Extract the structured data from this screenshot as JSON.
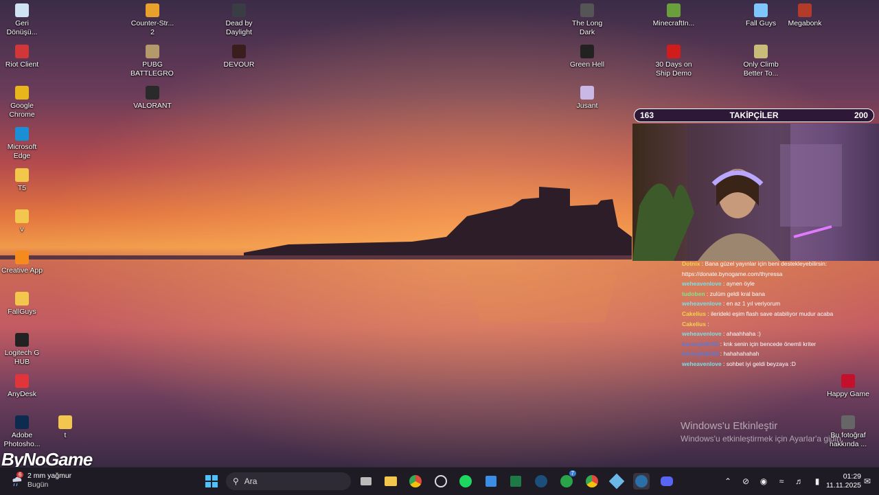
{
  "desktop_icons": [
    {
      "label": "Geri Dönüşü...",
      "icon": "recycle-bin-icon",
      "color": "#cfe3f2"
    },
    {
      "label": "Riot Client",
      "icon": "riot-icon",
      "color": "#d13639"
    },
    {
      "label": "Google Chrome",
      "icon": "chrome-icon",
      "color": "#e8b51c"
    },
    {
      "label": "Microsoft Edge",
      "icon": "edge-icon",
      "color": "#1a8fd6"
    },
    {
      "label": "T5",
      "icon": "shortcut-icon",
      "color": "#f2c84b"
    },
    {
      "label": "v",
      "icon": "folder-icon",
      "color": "#f3c74d"
    },
    {
      "label": "Creative App",
      "icon": "creative-app-icon",
      "color": "#f58a1f"
    },
    {
      "label": "FallGuys",
      "icon": "folder-icon",
      "color": "#f3c74d"
    },
    {
      "label": "Logitech G HUB",
      "icon": "logitech-icon",
      "color": "#222222"
    },
    {
      "label": "AnyDesk",
      "icon": "anydesk-icon",
      "color": "#e0353a"
    },
    {
      "label": "Adobe Photosho...",
      "icon": "photoshop-icon",
      "color": "#0d2b4f"
    },
    {
      "label": "t",
      "icon": "folder-icon",
      "color": "#f3c74d"
    },
    {
      "label": "Counter-Str... 2",
      "icon": "cs2-icon",
      "color": "#e8a12a"
    },
    {
      "label": "PUBG BATTLEGRO...",
      "icon": "pubg-icon",
      "color": "#b49a6a"
    },
    {
      "label": "VALORANT",
      "icon": "valorant-icon",
      "color": "#2a2a2a"
    },
    {
      "label": "Dead by Daylight",
      "icon": "dbd-icon",
      "color": "#3a3d44"
    },
    {
      "label": "DEVOUR",
      "icon": "devour-icon",
      "color": "#3a1d1d"
    },
    {
      "label": "The Long Dark",
      "icon": "long-dark-icon",
      "color": "#555555"
    },
    {
      "label": "Green Hell",
      "icon": "green-hell-icon",
      "color": "#222222"
    },
    {
      "label": "Jusant",
      "icon": "jusant-icon",
      "color": "#c9b7e6"
    },
    {
      "label": "MinecraftIn...",
      "icon": "minecraft-icon",
      "color": "#6aa03b"
    },
    {
      "label": "30 Days on Ship Demo",
      "icon": "30days-icon",
      "color": "#d11c1c"
    },
    {
      "label": "Fall Guys",
      "icon": "fall-guys-icon",
      "color": "#7fc6ff"
    },
    {
      "label": "Only Climb Better To...",
      "icon": "only-climb-icon",
      "color": "#c9bb7a"
    },
    {
      "label": "Megabonk",
      "icon": "megabonk-icon",
      "color": "#b33b2a"
    },
    {
      "label": "Happy Game",
      "icon": "happy-game-icon",
      "color": "#c4102b"
    },
    {
      "label": "Bu fotoğraf hakkında ...",
      "icon": "camera-info-icon",
      "color": "#666666"
    }
  ],
  "stream": {
    "followers_current": "163",
    "followers_title": "TAKİPÇİLER",
    "followers_goal": "200",
    "chat": [
      {
        "user": "Dotnix",
        "color": "#f5d34b",
        "text": ": Bana güzel yayınlar için beni destekleyebilirsin:"
      },
      {
        "user": "",
        "color": "#ffffff",
        "text": "https://donate.bynogame.com/thyressa"
      },
      {
        "user": "weheavenlove",
        "color": "#7be0e6",
        "text": ": aynen öyle"
      },
      {
        "user": "tudoben",
        "color": "#7ee68c",
        "text": ": zulüm geldi kral bana"
      },
      {
        "user": "weheavenlove",
        "color": "#7be0e6",
        "text": ": en az 1 yıl veriyorum"
      },
      {
        "user": "Cakelius",
        "color": "#f5d34b",
        "text": ": ilerideki eşim flash save atabiliyor mudur acaba"
      },
      {
        "user": "Cakelius",
        "color": "#f5d34b",
        "text": ":"
      },
      {
        "user": "weheavenlove",
        "color": "#7be0e6",
        "text": ": ahaahhaha :)"
      },
      {
        "user": "karanyildiz55",
        "color": "#5a7ad8",
        "text": ": knk senin için bencede önemli kriter"
      },
      {
        "user": "karanyildiz54",
        "color": "#5a7ad8",
        "text": ": hahahahahah"
      },
      {
        "user": "weheavenlove",
        "color": "#7be0e6",
        "text": ": sohbet iyi geldi beyzaya :D"
      }
    ]
  },
  "watermark": {
    "title": "Windows'u Etkinleştir",
    "subtitle": "Windows'u etkinleştirmek için Ayarlar'a gidin."
  },
  "brand": "ByNoGame",
  "taskbar": {
    "weather_badge": "6",
    "weather_text": "2 mm yağmur",
    "weather_sub": "Bugün",
    "search_placeholder": "Ara",
    "xbox_badge": "7",
    "time": "01:29",
    "date": "11.11.2025"
  }
}
